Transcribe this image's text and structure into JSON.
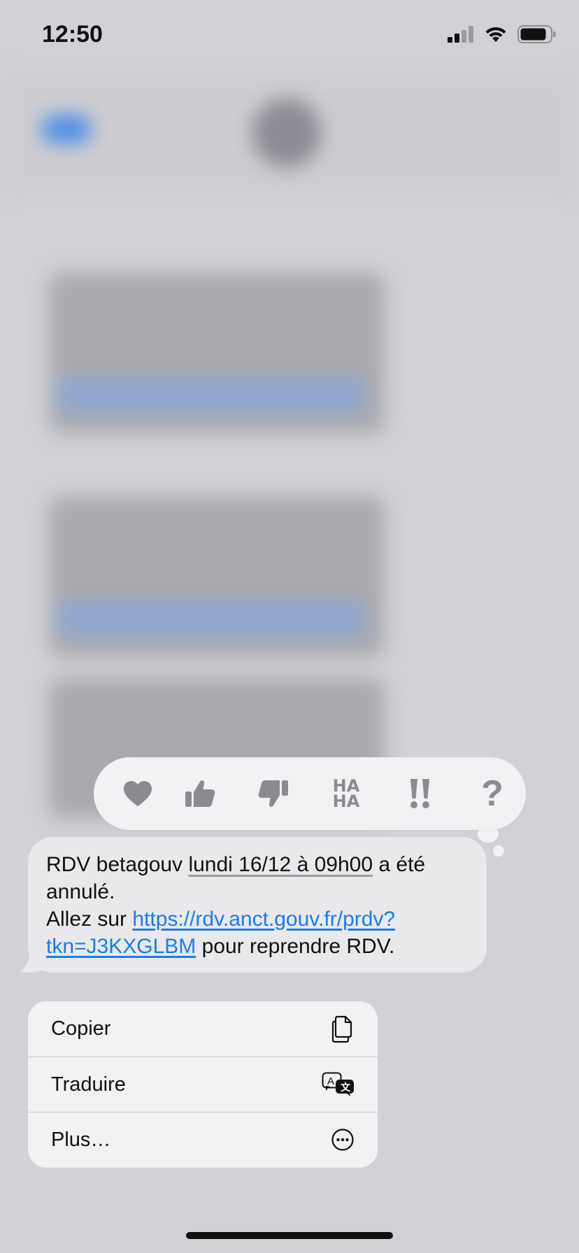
{
  "status_bar": {
    "time": "12:50",
    "icons": [
      "cellular-signal-icon",
      "wifi-icon",
      "battery-icon"
    ]
  },
  "reactions": [
    {
      "name": "heart"
    },
    {
      "name": "thumbs-up"
    },
    {
      "name": "thumbs-down"
    },
    {
      "name": "haha",
      "label_top": "HA",
      "label_bottom": "HA"
    },
    {
      "name": "exclamation",
      "label": "‼"
    },
    {
      "name": "question",
      "label": "?"
    }
  ],
  "message": {
    "text_prefix": "RDV betagouv ",
    "date_text": "lundi 16/12 à 09h00",
    "text_after_date": " a été annulé.",
    "line2_prefix": "Allez sur ",
    "link": "https://rdv.anct.gouv.fr/prdv?tkn=J3KXGLBM",
    "link_part1": "https://rdv.anct.gouv.fr/prdv?",
    "link_part2": "tkn=J3KXGLBM",
    "line2_suffix": " pour reprendre RDV."
  },
  "context_menu": {
    "items": [
      {
        "label": "Copier",
        "icon": "copy-icon"
      },
      {
        "label": "Traduire",
        "icon": "translate-icon"
      },
      {
        "label": "Plus…",
        "icon": "more-icon"
      }
    ]
  },
  "colors": {
    "background": "#d2d2d6",
    "bubble": "#e9e9eb",
    "link": "#1a7cf0",
    "menu": "#f2f2f4",
    "reaction_icon": "#8a8a8f"
  }
}
